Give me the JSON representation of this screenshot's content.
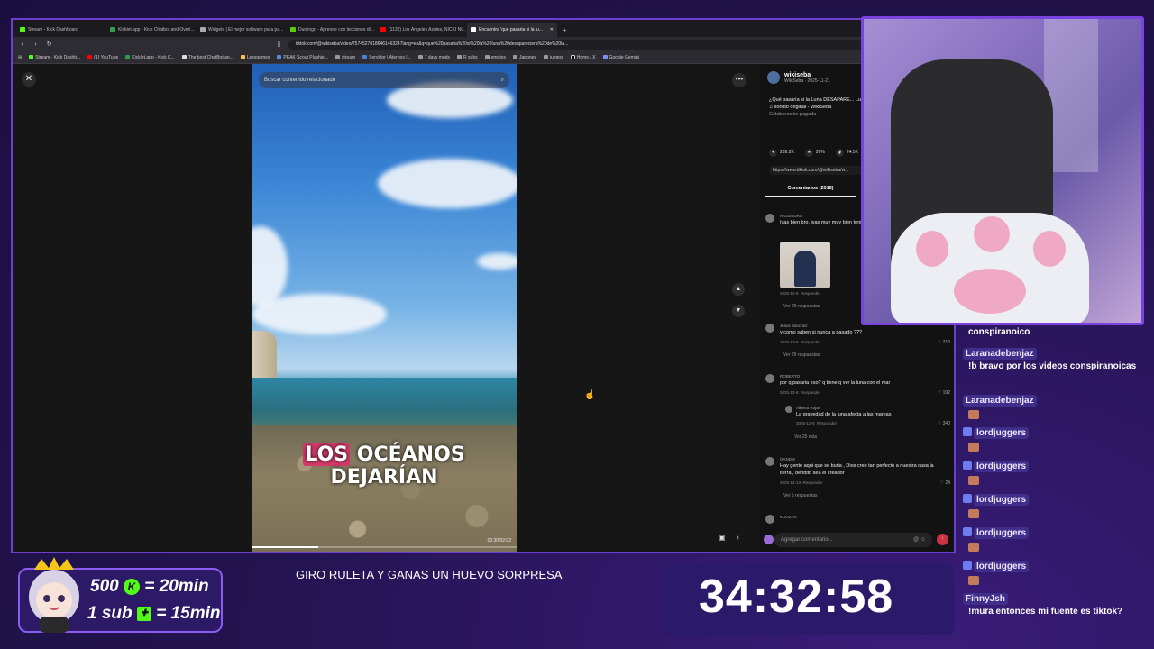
{
  "browser": {
    "tabs": [
      {
        "label": "Stream - Kick Dashboard",
        "color": "#53fc18"
      },
      {
        "label": "Kicklet.app - Kick Chatbot and Overl...",
        "color": "#2f9e4f"
      },
      {
        "label": "Widgets | El mejor software para pa...",
        "color": "#aaaaaa"
      },
      {
        "label": "Duolingo - Aprende con lecciones di...",
        "color": "#58cc02"
      },
      {
        "label": "(1132) Los Ángeles Azules, NICKI NI...",
        "color": "#ff0000"
      },
      {
        "label": "Encuentra 'que pasaria si la lu...",
        "color": "#ffffff"
      }
    ],
    "new_tab": "+",
    "url": "tiktok.com/@wikiseba/video/75745270186461463247lang=es&q=que%20pasaria%20si%20la%20luna%20desapareciera%20de%20la...",
    "bookmarks": [
      "Stream - Kick Dashb...",
      "(1) YouTube",
      "Kicklet.app - Kick C...",
      "The best ChatBot an...",
      "Lessgames",
      "PEAK Scout Plushie...",
      "stream",
      "Servidor | Aternos |...",
      "7 days mods",
      "R subs",
      "emotes",
      "Japones",
      "juegos",
      "Home / X",
      "Google Gemini"
    ]
  },
  "video": {
    "search_placeholder": "Buscar contenido relacionado",
    "caption_highlight": "LOS",
    "caption_rest": " OCÉANOS DEJARÍAN",
    "time": "00:30/02:02",
    "progress": 0.25
  },
  "panel": {
    "username": "wikiseba",
    "subtitle": "WikiSeba · 2025-11-21",
    "description": "¿Qué pasaría si la Luna DESAPARE... Luna, la Tierra colapsaría en cuesti...",
    "sound": "♫ sonido original - WikiSeba",
    "paid": "Colaboración pagada",
    "likes": "289.2K",
    "comments_count": "20%",
    "saves": "24.5K",
    "link": "https://www.tiktok.com/@wikiseba/vi...",
    "comments_tab": "Comentarios (2016)",
    "comments": [
      {
        "name": "HIGUIBURA",
        "text": "Ivas bien bro, ivas muy muy bien tenia que poner a esa ia en esto",
        "date": "2025-12-8",
        "reply": "Responder",
        "likes": "",
        "replies": "Ver 29 respuestas"
      },
      {
        "name": "Jésús Sánchez",
        "text": "y como saben si nunca a pasado ???",
        "date": "2025-12-8",
        "reply": "Responder",
        "likes": "213",
        "replies": "Ver 29 respuestas"
      },
      {
        "name": "ROBERTO",
        "text": "por q pasaria eso? q tiene q ver la luna con el mar",
        "date": "2025-12-8",
        "reply": "Responder",
        "likes": "192",
        "replies": ""
      },
      {
        "name": "Alberto Rojas",
        "text": "La gravedad de la luna afecta a las mareas",
        "date": "2025-12-8",
        "reply": "Responder",
        "likes": "340",
        "replies": "Ver 25 más"
      },
      {
        "name": "GANDI8",
        "text": "Hay gente aqui que se burla , Dios creo tan perfecto a nuestra casa la tierra , bendito sea el creador",
        "date": "2025-12-13",
        "reply": "Responder",
        "likes": "24",
        "replies": "Ver 5 respuestas"
      },
      {
        "name": "KIJOZAA",
        "text": "",
        "date": "",
        "reply": "",
        "likes": "",
        "replies": ""
      }
    ],
    "input_placeholder": "Agregar comentario..."
  },
  "chat": [
    {
      "name": "",
      "text": "conspiranoico"
    },
    {
      "name": "Laranadebenjaz",
      "text": "!b bravo por los videos conspiranoicas"
    },
    {
      "name": "Laranadebenjaz",
      "text": ""
    },
    {
      "name": "lordjuggers",
      "text": ""
    },
    {
      "name": "lordjuggers",
      "text": ""
    },
    {
      "name": "lordjuggers",
      "text": ""
    },
    {
      "name": "lordjuggers",
      "text": ""
    },
    {
      "name": "lordjuggers",
      "text": ""
    },
    {
      "name": "FinnyJsh",
      "text": "!mura entonces mi fuente es tiktok?"
    }
  ],
  "overlay": {
    "ticker": "GIRO RULETA Y GANAS UN HUEVO SORPRESA",
    "timer": "34:32:58",
    "reward1_amount": "500",
    "reward1_text": "= 20min",
    "reward2_text": "1 sub",
    "reward2_result": "= 15min",
    "kick_glyph": "K",
    "gift_glyph": "✚"
  }
}
